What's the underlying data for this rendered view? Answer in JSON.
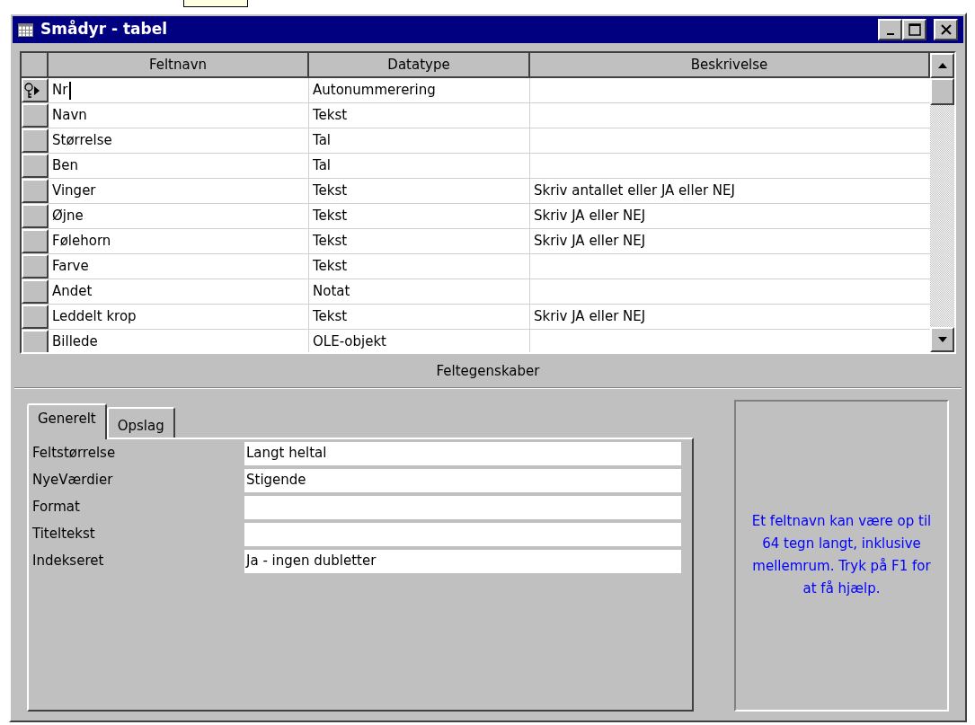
{
  "window": {
    "title": "Smådyr - tabel"
  },
  "table": {
    "columns": [
      "Feltnavn",
      "Datatype",
      "Beskrivelse"
    ],
    "rows": [
      {
        "field_name": "Nr",
        "data_type": "Autonummerering",
        "selected": true,
        "primary_key": true
      },
      {
        "field_name": "Navn",
        "data_type": "Tekst",
        "selected": false,
        "primary_key": false
      },
      {
        "field_name": "Størrelse",
        "data_type": "Tal",
        "selected": false,
        "primary_key": false
      },
      {
        "field_name": "Ben",
        "data_type": "Tal",
        "selected": false,
        "primary_key": false
      },
      {
        "field_name": "Vinger",
        "data_type": "Tekst",
        "description": "Skriv antallet eller JA eller NEJ",
        "selected": false,
        "primary_key": false
      },
      {
        "field_name": "Øjne",
        "data_type": "Tekst",
        "description": "Skriv JA eller NEJ",
        "selected": false,
        "primary_key": false
      },
      {
        "field_name": "Følehorn",
        "data_type": "Tekst",
        "description": "Skriv JA eller NEJ",
        "selected": false,
        "primary_key": false
      },
      {
        "field_name": "Farve",
        "data_type": "Tekst",
        "selected": false,
        "primary_key": false
      },
      {
        "field_name": "Andet",
        "data_type": "Notat",
        "selected": false,
        "primary_key": false
      },
      {
        "field_name": "Leddelt krop",
        "data_type": "Tekst",
        "description": "Skriv JA eller NEJ",
        "selected": false,
        "primary_key": false
      },
      {
        "field_name": "Billede",
        "data_type": "OLE-objekt",
        "selected": false,
        "primary_key": false
      }
    ]
  },
  "field_properties": {
    "heading": "Feltegenskaber",
    "tabs": [
      {
        "label": "Generelt",
        "selected": true
      },
      {
        "label": "Opslag",
        "selected": false
      }
    ],
    "properties": [
      {
        "label": "Feltstørrelse",
        "value": "Langt heltal"
      },
      {
        "label": "NyeVærdier",
        "value": "Stigende"
      },
      {
        "label": "Format"
      },
      {
        "label": "Titeltekst"
      },
      {
        "label": "Indekseret",
        "value": "Ja - ingen dubletter"
      }
    ],
    "help_text": "Et feltnavn kan være op til 64 tegn langt, inklusive mellemrum. Tryk på F1 for at få hjælp."
  }
}
